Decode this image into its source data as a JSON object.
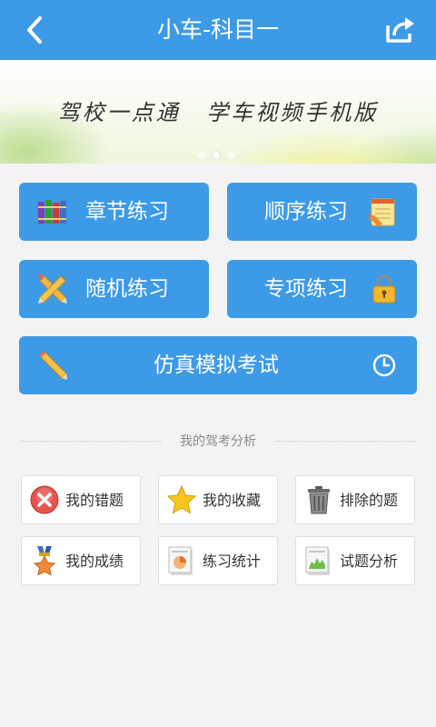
{
  "header": {
    "title": "小车-科目一",
    "back_icon": "back-arrow-icon",
    "share_icon": "share-icon",
    "bg_color": "#3d9ae6"
  },
  "banner": {
    "slogan": "驾校一点通 学车视频手机版",
    "page_count": 3,
    "active_page": 2
  },
  "main_buttons": {
    "chapter_practice": "章节练习",
    "sequential_practice": "顺序练习",
    "random_practice": "随机练习",
    "special_practice": "专项练习",
    "mock_exam": "仿真模拟考试"
  },
  "analysis": {
    "section_title": "我的驾考分析",
    "items": [
      {
        "label": "我的错题",
        "icon": "wrong-answers-icon"
      },
      {
        "label": "我的收藏",
        "icon": "star-icon"
      },
      {
        "label": "排除的题",
        "icon": "trash-can-icon"
      },
      {
        "label": "我的成绩",
        "icon": "medal-icon"
      },
      {
        "label": "练习统计",
        "icon": "statistics-chart-icon"
      },
      {
        "label": "试题分析",
        "icon": "analysis-chart-icon"
      }
    ]
  },
  "colors": {
    "accent": "#3d9ae6",
    "background": "#f3f3f3",
    "tile_border": "#dedede"
  }
}
